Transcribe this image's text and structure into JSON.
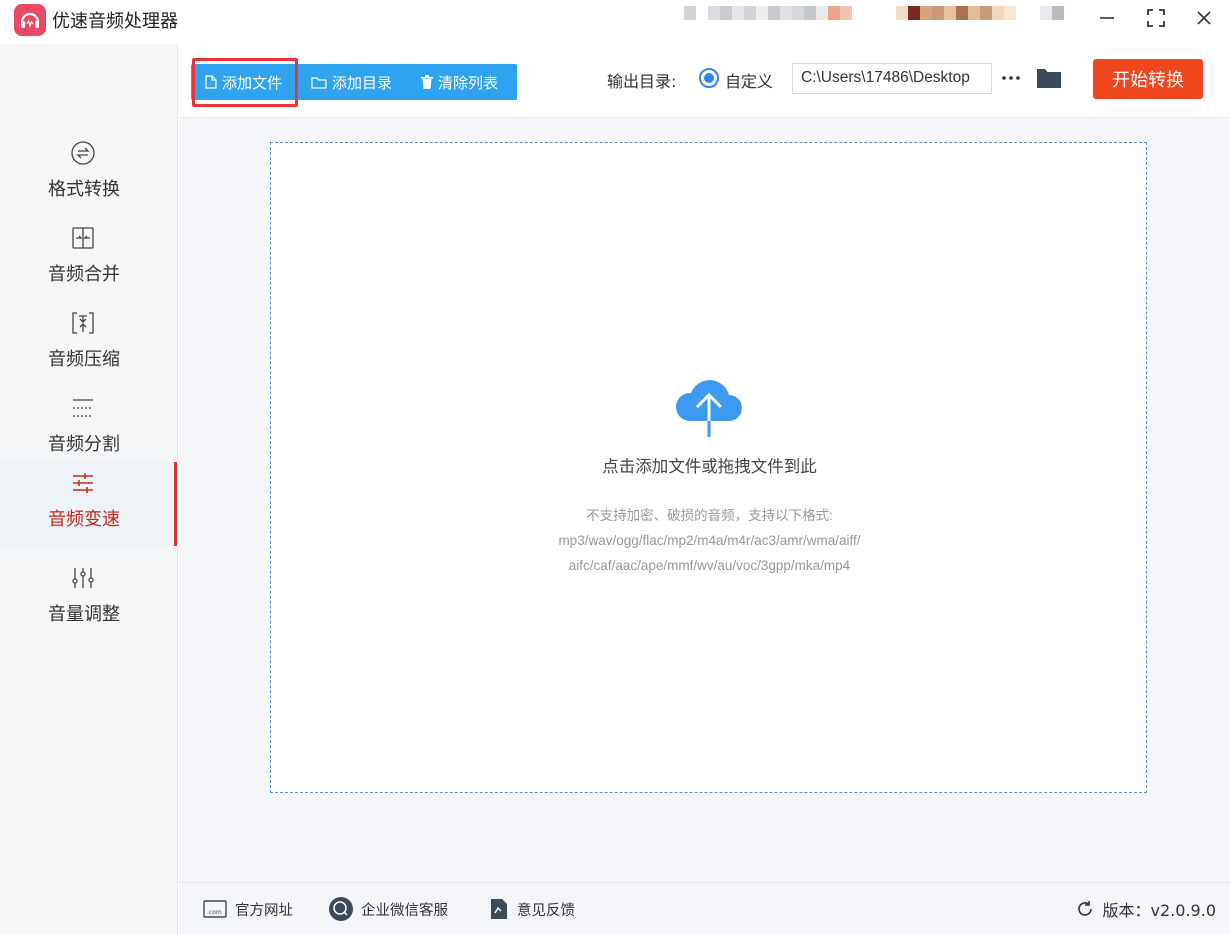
{
  "app": {
    "title": "优速音频处理器",
    "accent": "#2fa3ef",
    "danger": "#f0461d"
  },
  "window_controls": {
    "minimize": "minimize-icon",
    "maximize": "maximize-icon",
    "close": "close-icon"
  },
  "sidebar": {
    "items": [
      {
        "label": "格式转换",
        "icon": "format-convert-icon",
        "active": false
      },
      {
        "label": "音频合并",
        "icon": "merge-icon",
        "active": false
      },
      {
        "label": "音频压缩",
        "icon": "compress-icon",
        "active": false
      },
      {
        "label": "音频分割",
        "icon": "split-icon",
        "active": false
      },
      {
        "label": "音频变速",
        "icon": "speed-icon",
        "active": true
      },
      {
        "label": "音量调整",
        "icon": "volume-adjust-icon",
        "active": false
      }
    ]
  },
  "toolbar": {
    "add_file": "添加文件",
    "add_folder": "添加目录",
    "clear_list": "清除列表",
    "output_label": "输出目录:",
    "radio_custom": "自定义",
    "output_path": "C:\\Users\\17486\\Desktop",
    "start": "开始转换"
  },
  "dropzone": {
    "title": "点击添加文件或拖拽文件到此",
    "note_line1": "不支持加密、破损的音频，支持以下格式:",
    "note_line2": "mp3/wav/ogg/flac/mp2/m4a/m4r/ac3/amr/wma/aiff/",
    "note_line3": "aifc/caf/aac/ape/mmf/wv/au/voc/3gpp/mka/mp4"
  },
  "footer": {
    "website": "官方网址",
    "wechat": "企业微信客服",
    "feedback": "意见反馈",
    "version": "版本：v2.0.9.0"
  }
}
